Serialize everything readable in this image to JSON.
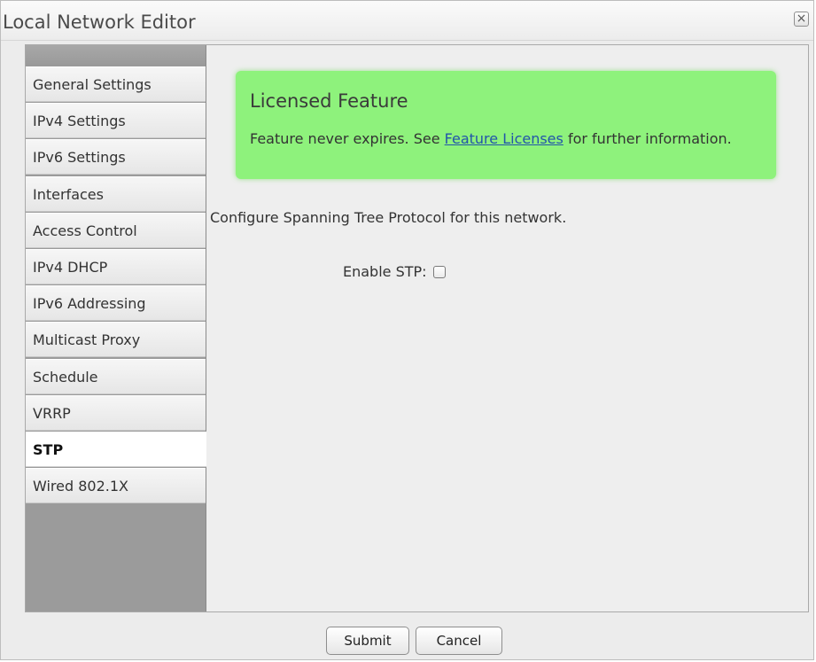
{
  "window": {
    "title": "Local Network Editor",
    "close_glyph": "×"
  },
  "sidebar": {
    "items": [
      {
        "label": "General Settings",
        "active": false
      },
      {
        "label": "IPv4 Settings",
        "active": false
      },
      {
        "label": "IPv6 Settings",
        "active": false
      },
      {
        "label": "Interfaces",
        "active": false
      },
      {
        "label": "Access Control",
        "active": false
      },
      {
        "label": "IPv4 DHCP",
        "active": false
      },
      {
        "label": "IPv6 Addressing",
        "active": false
      },
      {
        "label": "Multicast Proxy",
        "active": false
      },
      {
        "label": "Schedule",
        "active": false
      },
      {
        "label": "VRRP",
        "active": false
      },
      {
        "label": "STP",
        "active": true
      },
      {
        "label": "Wired 802.1X",
        "active": false
      }
    ]
  },
  "license": {
    "title": "Licensed Feature",
    "text_before": "Feature never expires. See ",
    "link": "Feature Licenses",
    "text_after": " for further information.",
    "color": "#8ef27c"
  },
  "stp": {
    "description": "Configure Spanning Tree Protocol for this network.",
    "enable_label": "Enable STP:",
    "enabled": false
  },
  "footer": {
    "submit_label": "Submit",
    "cancel_label": "Cancel"
  }
}
